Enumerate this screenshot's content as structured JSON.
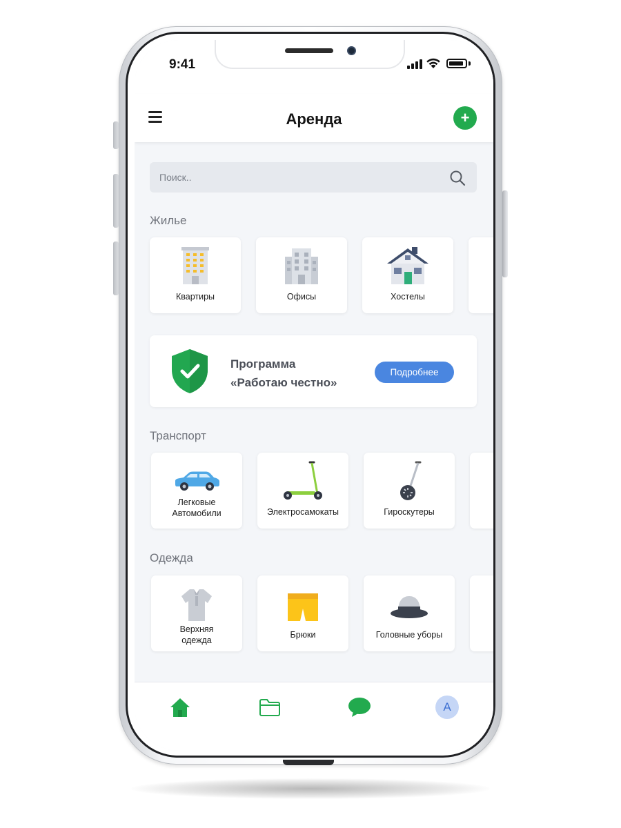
{
  "status_bar": {
    "time": "9:41"
  },
  "header": {
    "title": "Аренда",
    "add_label": "+"
  },
  "search": {
    "placeholder": "Поиск.."
  },
  "housing": {
    "title": "Жилье",
    "items": [
      {
        "label": "Квартиры",
        "icon": "apartment-building-icon"
      },
      {
        "label": "Офисы",
        "icon": "office-building-icon"
      },
      {
        "label": "Хостелы",
        "icon": "house-icon"
      }
    ]
  },
  "program": {
    "line1": "Программа",
    "line2": "«Работаю честно»",
    "button": "Подробнее",
    "icon": "shield-check-icon"
  },
  "transport": {
    "title": "Транспорт",
    "items": [
      {
        "label_line1": "Легковые",
        "label_line2": "Автомобили",
        "icon": "car-icon"
      },
      {
        "label": "Электросамокаты",
        "icon": "scooter-icon"
      },
      {
        "label": "Гироскутеры",
        "icon": "segway-icon"
      }
    ]
  },
  "clothing": {
    "title": "Одежда",
    "items": [
      {
        "label_line1": "Верхняя",
        "label_line2": "одежда",
        "icon": "shirt-icon"
      },
      {
        "label": "Брюки",
        "icon": "shorts-icon"
      },
      {
        "label": "Головные уборы",
        "icon": "hat-icon"
      }
    ]
  },
  "bottom_nav": {
    "items": [
      "home-icon",
      "folder-icon",
      "chat-icon",
      "avatar"
    ],
    "avatar_letter": "A"
  },
  "colors": {
    "accent_green": "#22aa4e",
    "button_blue": "#4a86e0",
    "background": "#f4f6f9"
  }
}
